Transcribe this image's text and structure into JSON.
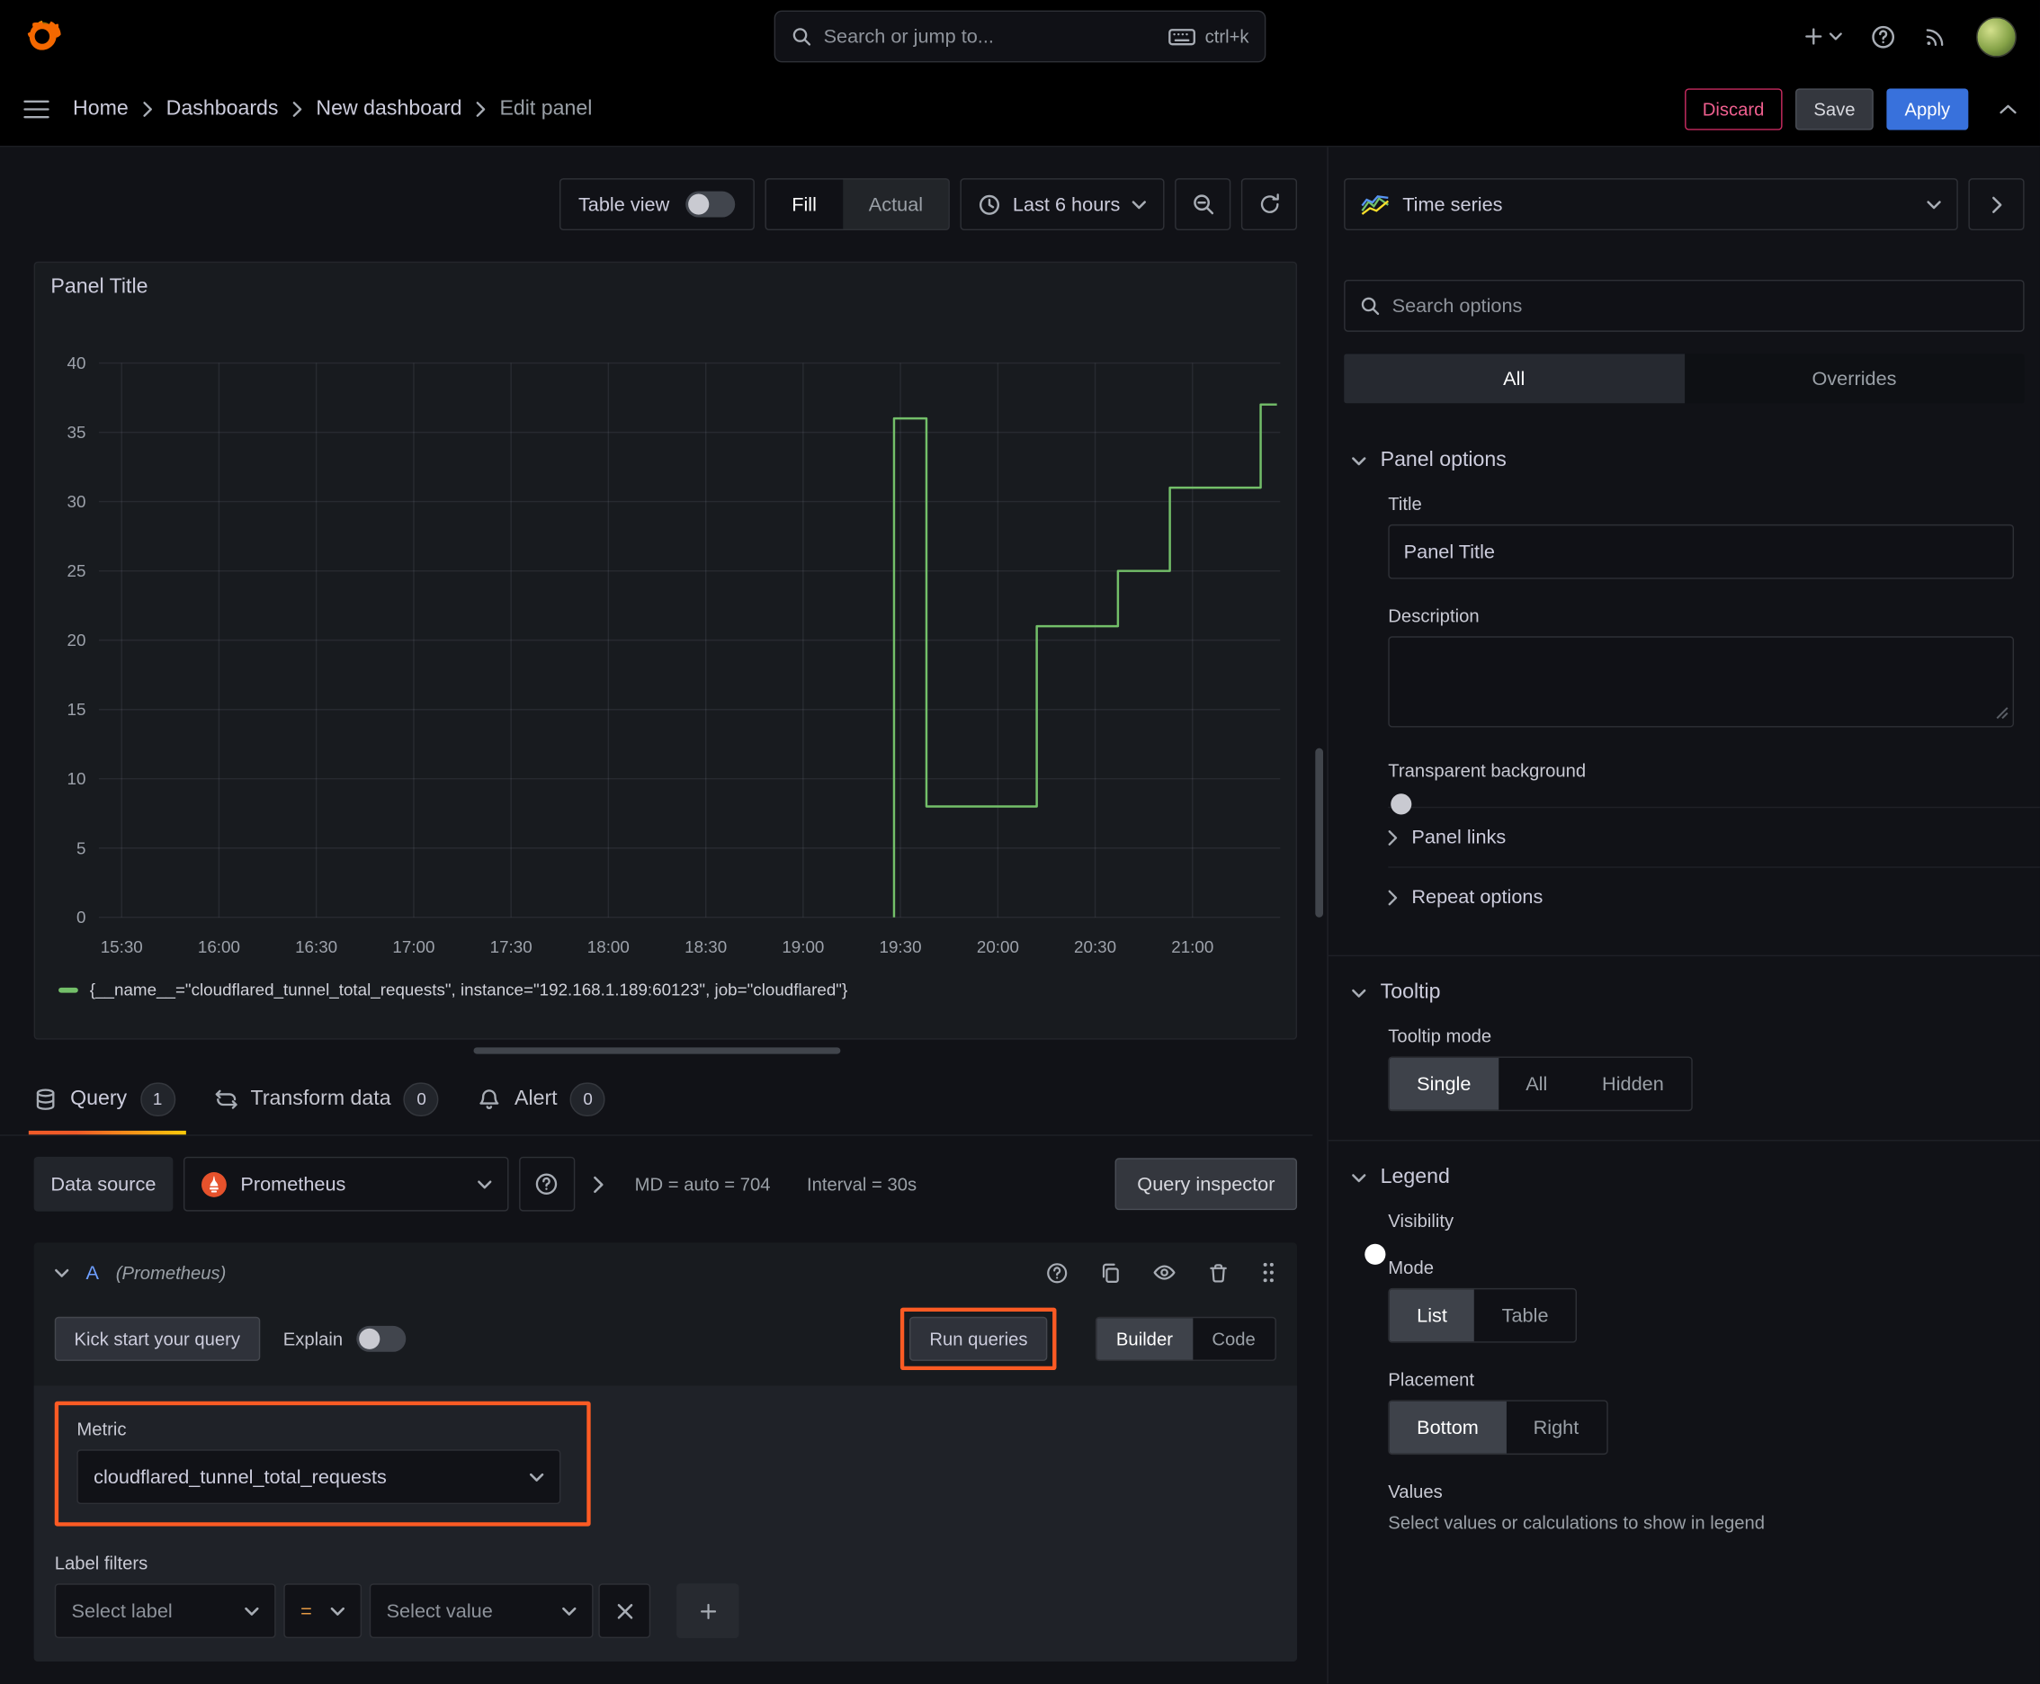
{
  "colors": {
    "accent_orange": "#ff780a",
    "primary_blue": "#3871dc",
    "series_green": "#73bf69",
    "annotation_orange": "#fc5b24",
    "destructive_pink": "#e0226e"
  },
  "topnav": {
    "search_placeholder": "Search or jump to...",
    "shortcut": "ctrl+k"
  },
  "breadcrumb": {
    "items": [
      "Home",
      "Dashboards",
      "New dashboard",
      "Edit panel"
    ]
  },
  "actions": {
    "discard": "Discard",
    "save": "Save",
    "apply": "Apply"
  },
  "toolbar": {
    "table_view_label": "Table view",
    "display_modes": [
      "Fill",
      "Actual"
    ],
    "active_display_mode": "Fill",
    "time_range": "Last 6 hours"
  },
  "panel": {
    "title": "Panel Title"
  },
  "chart_data": {
    "type": "line",
    "line_style": "step-after",
    "title": "Panel Title",
    "x_ticks": [
      "15:30",
      "16:00",
      "16:30",
      "17:00",
      "17:30",
      "18:00",
      "18:30",
      "19:00",
      "19:30",
      "20:00",
      "20:30",
      "21:00"
    ],
    "x_domain": [
      "15:23",
      "21:27"
    ],
    "y_ticks": [
      0,
      5,
      10,
      15,
      20,
      25,
      30,
      35,
      40
    ],
    "ylim": [
      0,
      40
    ],
    "grid": true,
    "legend_position": "bottom",
    "series": [
      {
        "name": "{__name__=\"cloudflared_tunnel_total_requests\", instance=\"192.168.1.189:60123\", job=\"cloudflared\"}",
        "color": "#73bf69",
        "points": [
          [
            "19:28",
            0
          ],
          [
            "19:28",
            36
          ],
          [
            "19:38",
            36
          ],
          [
            "19:38",
            8
          ],
          [
            "20:12",
            8
          ],
          [
            "20:12",
            21
          ],
          [
            "20:37",
            21
          ],
          [
            "20:37",
            25
          ],
          [
            "20:53",
            25
          ],
          [
            "20:53",
            31
          ],
          [
            "21:21",
            31
          ],
          [
            "21:21",
            37
          ],
          [
            "21:26",
            37
          ]
        ]
      }
    ]
  },
  "tabs": [
    {
      "label": "Query",
      "count": "1"
    },
    {
      "label": "Transform data",
      "count": "0"
    },
    {
      "label": "Alert",
      "count": "0"
    }
  ],
  "query": {
    "datasource_label": "Data source",
    "datasource_name": "Prometheus",
    "max_data_points": "MD = auto = 704",
    "interval": "Interval = 30s",
    "query_inspector": "Query inspector",
    "ref_id": "A",
    "ref_datasource": "(Prometheus)",
    "kick_start": "Kick start your query",
    "explain_label": "Explain",
    "run_queries": "Run queries",
    "editor_modes": [
      "Builder",
      "Code"
    ],
    "active_editor_mode": "Builder",
    "metric_label": "Metric",
    "metric_value": "cloudflared_tunnel_total_requests",
    "label_filters_label": "Label filters",
    "select_label_placeholder": "Select label",
    "operator": "=",
    "select_value_placeholder": "Select value"
  },
  "options": {
    "viz_type": "Time series",
    "search_placeholder": "Search options",
    "filter_tabs": [
      "All",
      "Overrides"
    ],
    "active_filter_tab": "All",
    "panel_options": {
      "header": "Panel options",
      "title_label": "Title",
      "title_value": "Panel Title",
      "description_label": "Description",
      "transparent_label": "Transparent background",
      "panel_links": "Panel links",
      "repeat_options": "Repeat options"
    },
    "tooltip": {
      "header": "Tooltip",
      "mode_label": "Tooltip mode",
      "modes": [
        "Single",
        "All",
        "Hidden"
      ],
      "active_mode": "Single"
    },
    "legend": {
      "header": "Legend",
      "visibility_label": "Visibility",
      "visibility_on": true,
      "mode_label": "Mode",
      "modes": [
        "List",
        "Table"
      ],
      "active_mode": "List",
      "placement_label": "Placement",
      "placements": [
        "Bottom",
        "Right"
      ],
      "active_placement": "Bottom",
      "values_label": "Values",
      "values_hint": "Select values or calculations to show in legend"
    }
  }
}
